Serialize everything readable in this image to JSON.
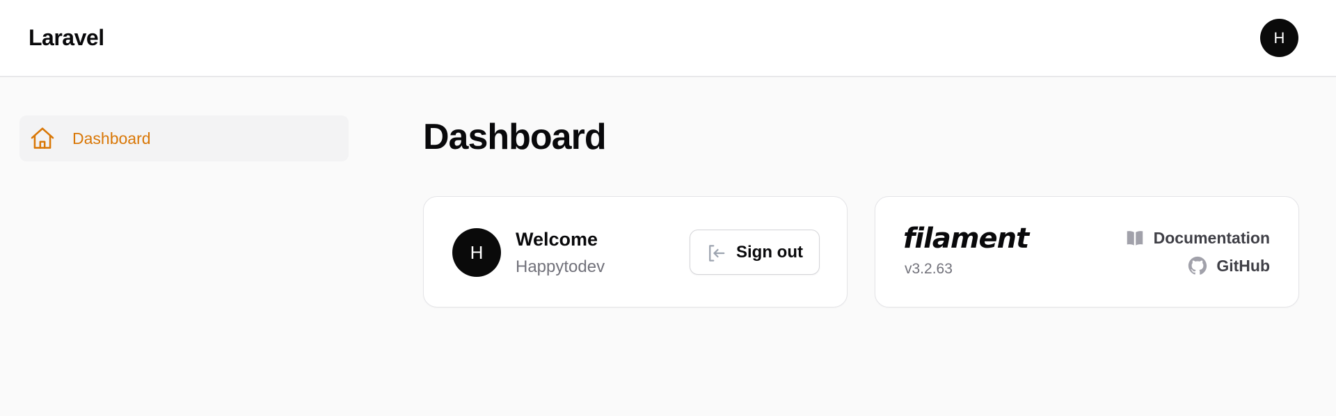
{
  "app": {
    "brand": "Laravel",
    "user_initial": "H"
  },
  "sidebar": {
    "items": [
      {
        "label": "Dashboard",
        "icon": "home-icon",
        "active": true
      }
    ]
  },
  "main": {
    "title": "Dashboard",
    "welcome_card": {
      "title": "Welcome",
      "user_name": "Happytodev",
      "avatar_initial": "H",
      "sign_out_label": "Sign out"
    },
    "filament_card": {
      "logo_text": "filament",
      "version": "v3.2.63",
      "links": [
        {
          "label": "Documentation",
          "icon": "book-open-icon"
        },
        {
          "label": "GitHub",
          "icon": "github-icon"
        }
      ]
    }
  },
  "colors": {
    "accent": "#d97706",
    "text_primary": "#09090b",
    "text_muted": "#71717a",
    "page_background": "#fafafa",
    "card_background": "#ffffff"
  }
}
